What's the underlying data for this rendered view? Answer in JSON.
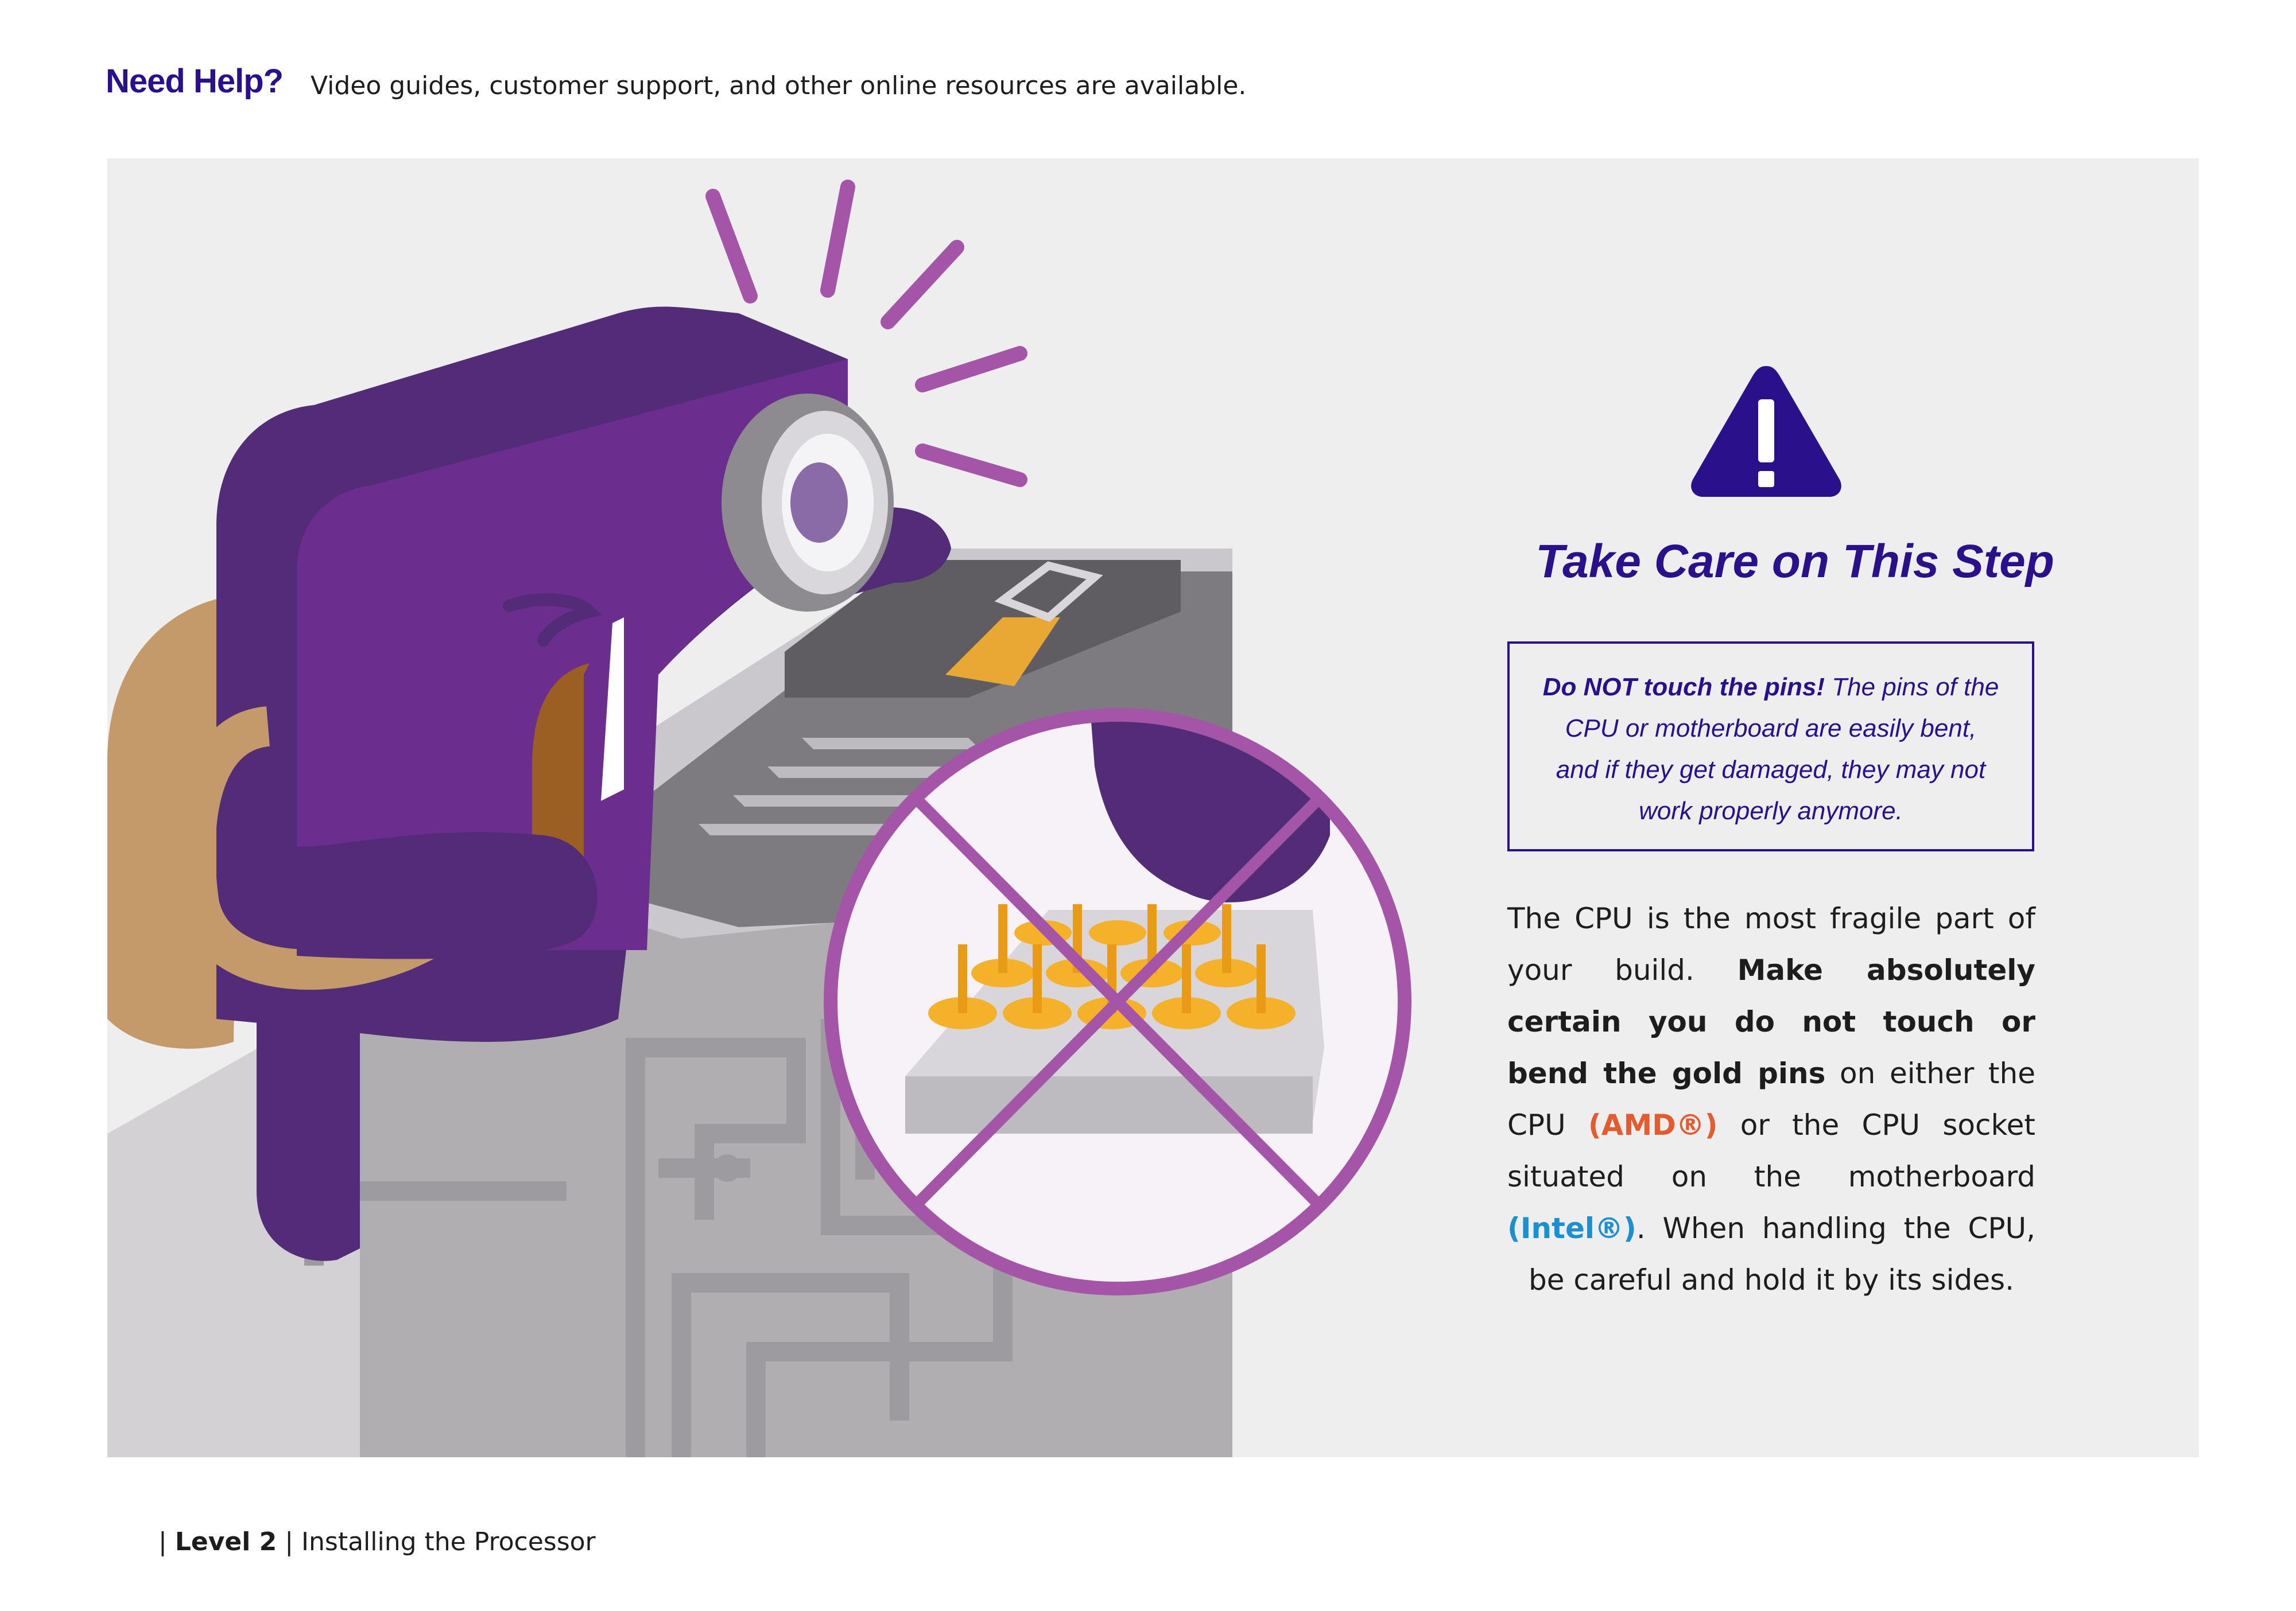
{
  "header": {
    "title": "Need Help?",
    "text": "Video guides, customer support, and other online resources are available."
  },
  "warning": {
    "title": "Take Care on This Step",
    "note_bold": "Do NOT touch the pins!",
    "note_text": " The pins of the CPU or motherboard are easily bent, and if they get damaged, they may not work properly anymore.",
    "body": {
      "p1": "The CPU is the most fragile part of your build. ",
      "bold": "Make absolutely certain you do not touch or bend the gold pins",
      "p2": " on either the CPU ",
      "amd": "(AMD®)",
      "p3": " or the CPU socket situated on the motherboard ",
      "intel": "(Intel®)",
      "p4": ". When handling the CPU, be careful and hold it by its sides."
    }
  },
  "footer": {
    "sep1": "| ",
    "level": "Level 2",
    "sep2": " | ",
    "section": "Installing the Processor"
  },
  "colors": {
    "brand_purple": "#2a108a",
    "mascot_purple": "#6b2d8e",
    "prohibition": "#a455a8",
    "amd": "#e35b2f",
    "intel": "#1c8fcf",
    "panel_bg": "#efeeef"
  },
  "icons": [
    "warning-triangle-icon",
    "no-touch-prohibition-icon"
  ]
}
